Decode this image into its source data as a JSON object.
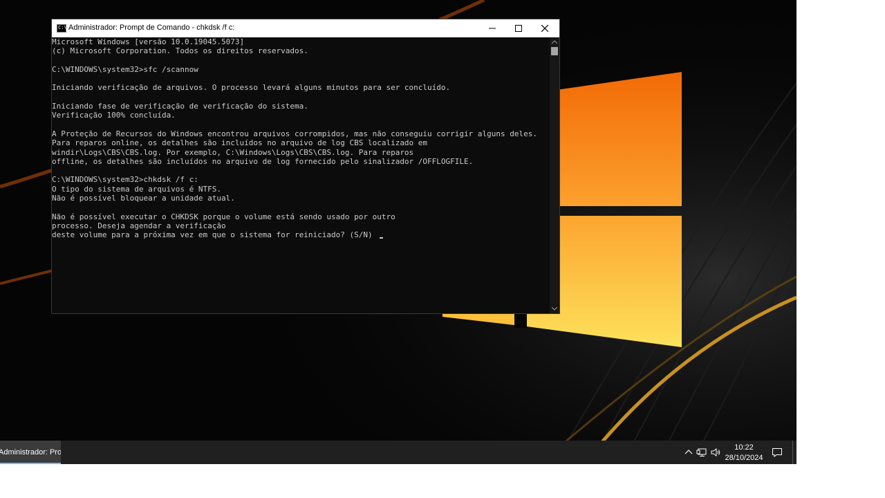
{
  "window": {
    "title": "Administrador: Prompt de Comando - chkdsk  /f c:",
    "icon": "cmd-icon",
    "controls": [
      "minimize-icon",
      "maximize-icon",
      "close-icon"
    ]
  },
  "console": {
    "lines": [
      "Microsoft Windows [versão 10.0.19045.5073]",
      "(c) Microsoft Corporation. Todos os direitos reservados.",
      "",
      "C:\\WINDOWS\\system32>sfc /scannow",
      "",
      "Iniciando verificação de arquivos. O processo levará alguns minutos para ser concluído.",
      "",
      "Iniciando fase de verificação de verificação do sistema.",
      "Verificação 100% concluída.",
      "",
      "A Proteção de Recursos do Windows encontrou arquivos corrompidos, mas não conseguiu corrigir alguns deles.",
      "Para reparos online, os detalhes são incluídos no arquivo de log CBS localizado em",
      "windir\\Logs\\CBS\\CBS.log. Por exemplo, C:\\Windows\\Logs\\CBS\\CBS.log. Para reparos",
      "offline, os detalhes são incluídos no arquivo de log fornecido pelo sinalizador /OFFLOGFILE.",
      "",
      "C:\\WINDOWS\\system32>chkdsk /f c:",
      "O tipo do sistema de arquivos é NTFS.",
      "Não é possível bloquear a unidade atual.",
      "",
      "Não é possível executar o CHKDSK porque o volume está sendo usado por outro",
      "processo. Deseja agendar a verificação",
      "deste volume para a próxima vez em que o sistema for reiniciado? (S/N) "
    ]
  },
  "taskbar": {
    "app_label": "Administrador: Prompt de Comando",
    "tray_icons": [
      "chevron-up-icon",
      "network-icon",
      "volume-icon"
    ],
    "time": "10:22",
    "date": "28/10/2024",
    "notification_icon": "action-center-icon"
  },
  "colors": {
    "console_bg": "#0c0c0c",
    "console_text": "#cccccc",
    "taskbar_bg": "#202020",
    "accent": "#76b9ed",
    "logo_top": "#f26a06",
    "logo_bottom": "#fccd3e"
  }
}
